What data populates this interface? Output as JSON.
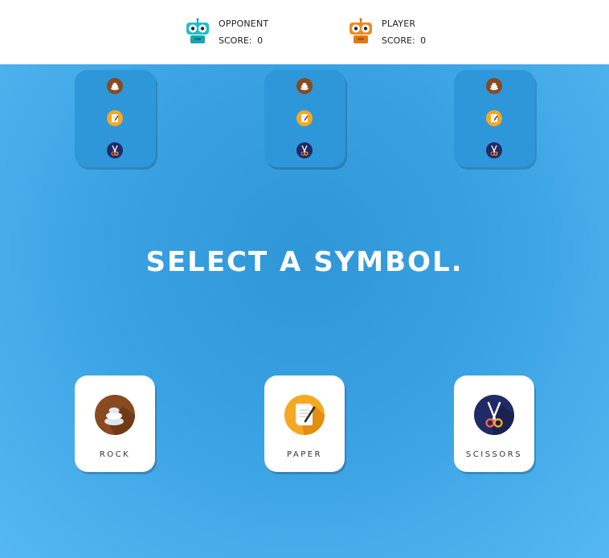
{
  "headline": "SELECT A SYMBOL.",
  "opponent": {
    "name": "OPPONENT",
    "score_label": "SCORE:",
    "score": "0",
    "avatar_icon": "robot-teal-icon",
    "color": "#1fc0c8"
  },
  "player": {
    "name": "PLAYER",
    "score_label": "SCORE:",
    "score": "0",
    "avatar_icon": "robot-orange-icon",
    "color": "#f08a1c"
  },
  "mini_cards": [
    {
      "icons": [
        "rock-icon",
        "paper-icon",
        "scissors-icon"
      ]
    },
    {
      "icons": [
        "rock-icon",
        "paper-icon",
        "scissors-icon"
      ]
    },
    {
      "icons": [
        "rock-icon",
        "paper-icon",
        "scissors-icon"
      ]
    }
  ],
  "choices": [
    {
      "label": "ROCK",
      "icon": "rock-icon",
      "color": "#8a4a1f"
    },
    {
      "label": "PAPER",
      "icon": "paper-icon",
      "color": "#f7a823"
    },
    {
      "label": "SCISSORS",
      "icon": "scissors-icon",
      "color": "#1f2a66"
    }
  ],
  "colors": {
    "background": "#3aa2e3",
    "mini_card": "#2d97da",
    "header": "#ffffff"
  }
}
